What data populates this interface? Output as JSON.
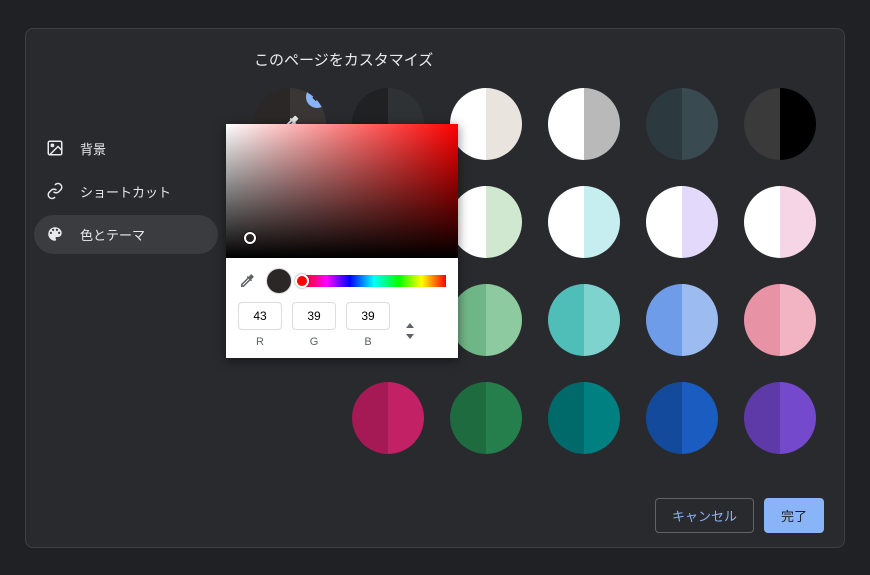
{
  "title": "このページをカスタマイズ",
  "sidebar": {
    "items": [
      {
        "label": "背景"
      },
      {
        "label": "ショートカット"
      },
      {
        "label": "色とテーマ"
      }
    ],
    "active_index": 2
  },
  "swatches": [
    {
      "left": "#2b2727",
      "right": "#3a3636",
      "selected": true,
      "custom": true
    },
    {
      "left": "#1f2123",
      "right": "#2f3234"
    },
    {
      "left": "#ffffff",
      "right": "#e9e4de"
    },
    {
      "left": "#ffffff",
      "right": "#b9b9b9"
    },
    {
      "left": "#2c3a40",
      "right": "#3a4a51"
    },
    {
      "left": "#3a3a3a",
      "right": "#000000"
    },
    {
      "left": "#ffffff",
      "right": "#cfe8cf"
    },
    {
      "left": "#ffffff",
      "right": "#c6eef0"
    },
    {
      "left": "#ffffff",
      "right": "#e3d9fb"
    },
    {
      "left": "#ffffff",
      "right": "#f6d6e6"
    },
    {
      "left": "#6fb686",
      "right": "#8ecaa0"
    },
    {
      "left": "#4fbdb8",
      "right": "#7fd3cf"
    },
    {
      "left": "#6f9ce8",
      "right": "#9cbcf0"
    },
    {
      "left": "#e892a6",
      "right": "#f2b4c2"
    },
    {
      "left": "#a51a55",
      "right": "#c22166"
    },
    {
      "left": "#1e6b40",
      "right": "#257f4c"
    },
    {
      "left": "#006a6a",
      "right": "#008080"
    },
    {
      "left": "#144a9b",
      "right": "#1a5cbf"
    },
    {
      "left": "#5e3aa8",
      "right": "#7449cc"
    }
  ],
  "picker": {
    "r": "43",
    "g": "39",
    "b": "39",
    "labels": {
      "r": "R",
      "g": "G",
      "b": "B"
    }
  },
  "footer": {
    "cancel": "キャンセル",
    "done": "完了"
  }
}
